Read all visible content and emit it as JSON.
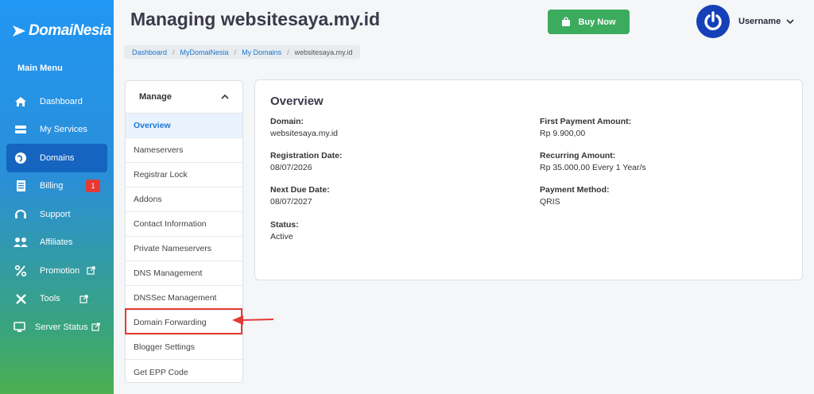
{
  "sidebar": {
    "brand": "DomaiNesia",
    "menu_title": "Main Menu",
    "items": [
      {
        "label": "Dashboard",
        "icon": "home-icon"
      },
      {
        "label": "My Services",
        "icon": "server-icon"
      },
      {
        "label": "Domains",
        "icon": "globe-icon",
        "active": true
      },
      {
        "label": "Billing",
        "icon": "invoice-icon",
        "badge": "1"
      },
      {
        "label": "Support",
        "icon": "headset-icon"
      },
      {
        "label": "Affiliates",
        "icon": "users-icon"
      },
      {
        "label": "Promotion",
        "icon": "percent-icon",
        "external": true
      },
      {
        "label": "Tools",
        "icon": "tools-icon",
        "external": true
      },
      {
        "label": "Server Status",
        "icon": "monitor-icon",
        "external": true
      }
    ]
  },
  "header": {
    "title": "Managing websitesaya.my.id",
    "buy_label": "Buy Now",
    "username": "Username"
  },
  "breadcrumb": [
    "Dashboard",
    "MyDomaiNesia",
    "My Domains",
    "websitesaya.my.id"
  ],
  "manage": {
    "title": "Manage",
    "items": [
      "Overview",
      "Nameservers",
      "Registrar Lock",
      "Addons",
      "Contact Information",
      "Private Nameservers",
      "DNS Management",
      "DNSSec Management",
      "Domain Forwarding",
      "Blogger Settings",
      "Get EPP Code"
    ]
  },
  "overview": {
    "title": "Overview",
    "domain_label": "Domain:",
    "domain": "websitesaya.my.id",
    "reg_label": "Registration Date:",
    "reg": "08/07/2026",
    "due_label": "Next Due Date:",
    "due": "08/07/2027",
    "status_label": "Status:",
    "status": "Active",
    "first_label": "First Payment Amount:",
    "first": "Rp 9.900,00",
    "recurring_label": "Recurring Amount:",
    "recurring": "Rp 35.000,00 Every 1 Year/s",
    "method_label": "Payment Method:",
    "method": "QRIS"
  },
  "colors": {
    "accent": "#1976d2",
    "buy": "#3bab5e",
    "highlight": "#e53935"
  }
}
